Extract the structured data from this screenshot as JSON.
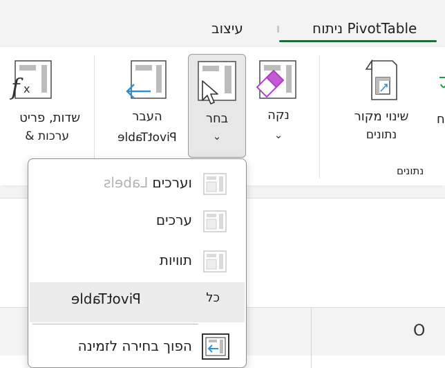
{
  "tabs": {
    "analyze": "ניתוח PivotTable",
    "design": "עיצוב"
  },
  "ribbon": {
    "change_source": {
      "line1": "שינוי מקור",
      "line2": "נתונים"
    },
    "clear": {
      "label": "נקה"
    },
    "select": {
      "label": "בחר"
    },
    "move": {
      "line1": "העבר",
      "line2": "PivotTable"
    },
    "fields": {
      "line1": "שדות, פריט",
      "line2": "& ערכות"
    },
    "data_group_label": "נתונים",
    "clipped_left_glyph": "ח"
  },
  "menu": {
    "items": [
      {
        "text": "Labels וערכים",
        "part_disabled": "Labels",
        "part_enabled": "וערכים"
      },
      {
        "text": "ערכים"
      },
      {
        "text": "תוויות"
      },
      {
        "text": "PivotTable",
        "shortcut": "כל"
      },
      {
        "text": "הפוך בחירה לזמינה"
      }
    ]
  },
  "sheet": {
    "column_label": "O"
  },
  "colors": {
    "accent_green": "#1e6b3a",
    "blue_arrow": "#2f8fd8",
    "purple_eraser": "#b040c8"
  }
}
